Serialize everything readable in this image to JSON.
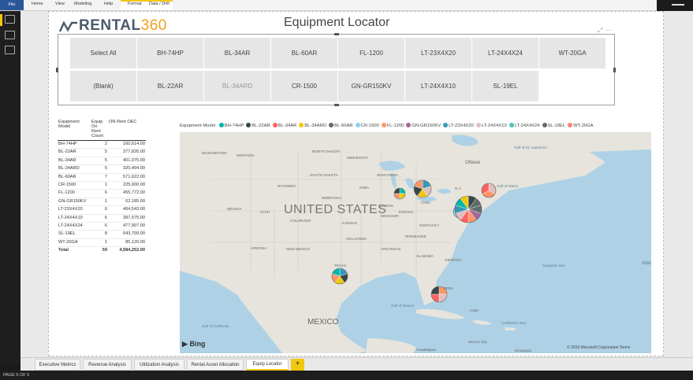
{
  "ribbon": {
    "file": "File",
    "home": "Home",
    "view": "View",
    "modeling": "Modeling",
    "help": "Help",
    "format": "Format",
    "data_drill": "Data / Drill"
  },
  "logo": {
    "text": "RENTAL",
    "number": "360"
  },
  "title": "Equipment Locator",
  "slicer": {
    "items": [
      "Select All",
      "BH-74HP",
      "BL-34AR",
      "BL-60AR",
      "FL-1200",
      "LT-23X4X20",
      "LT-24X4X24",
      "WT-20GA",
      "(Blank)",
      "BL-22AR",
      "BL-34ARD",
      "CR-1500",
      "GN-GR150KV",
      "LT-24X4X10",
      "SL-19EL"
    ]
  },
  "table": {
    "headers": [
      "Equipment Model",
      "Equip On Rent Count",
      "ON Rent OEC"
    ],
    "rows": [
      [
        "BH-74HP",
        "2",
        "160,614.00"
      ],
      [
        "BL-22AR",
        "5",
        "377,826.00"
      ],
      [
        "BL-34AR",
        "5",
        "401,975.00"
      ],
      [
        "BL-34ARD",
        "5",
        "320,404.00"
      ],
      [
        "BL-60AR",
        "7",
        "571,622.00"
      ],
      [
        "CR-1500",
        "1",
        "225,000.00"
      ],
      [
        "FL-1200",
        "6",
        "455,772.00"
      ],
      [
        "GN-GR150KV",
        "1",
        "62,185.00"
      ],
      [
        "LT-23X4X20",
        "6",
        "404,543.00"
      ],
      [
        "LT-24X4X10",
        "6",
        "397,575.00"
      ],
      [
        "LT-24X4X24",
        "6",
        "477,907.00"
      ],
      [
        "SL-19EL",
        "8",
        "643,709.00"
      ],
      [
        "WT-20GA",
        "1",
        "85,120.00"
      ]
    ],
    "total": [
      "Total",
      "59",
      "4,584,252.00"
    ]
  },
  "legend": {
    "title": "Equipment Model",
    "items": [
      {
        "label": "BH-74HP",
        "color": "#01b8aa"
      },
      {
        "label": "BL-22AR",
        "color": "#374649"
      },
      {
        "label": "BL-34AR",
        "color": "#fd625e"
      },
      {
        "label": "BL-34ARD",
        "color": "#f2c80f"
      },
      {
        "label": "BL-60AR",
        "color": "#5f6b6d"
      },
      {
        "label": "CR-1500",
        "color": "#8ad4eb"
      },
      {
        "label": "FL-1200",
        "color": "#fe9666"
      },
      {
        "label": "GN-GR150KV",
        "color": "#a66999"
      },
      {
        "label": "LT-23X4X20",
        "color": "#3599b8"
      },
      {
        "label": "LT-24X4X10",
        "color": "#dfbfbf"
      },
      {
        "label": "LT-24X4X24",
        "color": "#4ac5bb"
      },
      {
        "label": "SL-19EL",
        "color": "#5f6b6d"
      },
      {
        "label": "WT-20GA",
        "color": "#fb8281"
      }
    ]
  },
  "map": {
    "country": "UNITED STATES",
    "mexico": "MEXICO",
    "labels": [
      "WASHINGTON",
      "MONTANA",
      "NORTH DAKOTA",
      "MINNESOTA",
      "SOUTH DAKOTA",
      "WISCONSIN",
      "WYOMING",
      "IOWA",
      "NEBRASKA",
      "NEVADA",
      "UTAH",
      "COLORADO",
      "KANSAS",
      "MISSOURI",
      "ILLINOIS",
      "INDIANA",
      "OHIO",
      "KENTUCKY",
      "TENNESSEE",
      "OKLAHOMA",
      "ARIZONA",
      "NEW MEXICO",
      "ARKANSAS",
      "ALABAMA",
      "GEORGIA",
      "TEXAS",
      "FLORIDA",
      "Ottawa",
      "N.Y.",
      "Gulf of Maine",
      "Gulf of St. Lawrence",
      "Gulf of Mexico",
      "Sargasso Sea",
      "Gulf of California",
      "Cuba",
      "Caribbean Sea",
      "Guadalajara",
      "Mexico City",
      "Nicaragua",
      "Atlantic Ocean"
    ],
    "bing": "Bing",
    "copyright": "© 2019 Microsoft Corporation  Terms"
  },
  "tabs": [
    "Executive Metrics",
    "Revenue Analysis",
    "Utilization Analysis",
    "Rental Asset Allocation",
    "Equip Locator"
  ],
  "tab_add": "+",
  "status": "PAGE 5 OF 5"
}
